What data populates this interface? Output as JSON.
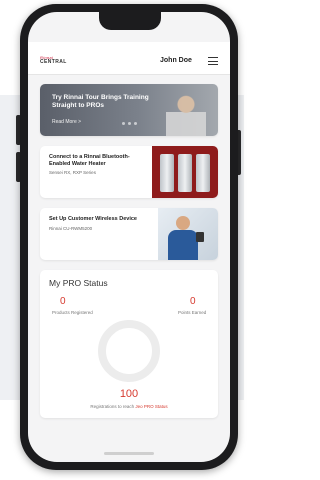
{
  "app": {
    "logo_top": "Rinnai",
    "logo_bottom": "CENTRAL",
    "user_name": "John Doe"
  },
  "hero": {
    "title": "Try Rinnai Tour Brings Training Straight to PROs",
    "link": "Read More  >"
  },
  "cards": [
    {
      "title": "Connect to a Rinnai Bluetooth-Enabled Water Heater",
      "subtitle": "Sensei RX, RXP Series"
    },
    {
      "title": "Set Up Customer Wireless Device",
      "subtitle": "Rinnai CU-RWM5200"
    }
  ],
  "status": {
    "title": "My PRO Status",
    "products_registered_value": "0",
    "products_registered_label": "Products Registered",
    "points_earned_value": "0",
    "points_earned_label": "Points Earned",
    "registrations_value": "100",
    "registrations_label": "Registrations to reach ",
    "registrations_highlight": "Jeo PRO Status"
  },
  "colors": {
    "accent": "#d63a2f",
    "phone_body": "#1c1c1e",
    "screen_bg": "#f4f4f5"
  }
}
